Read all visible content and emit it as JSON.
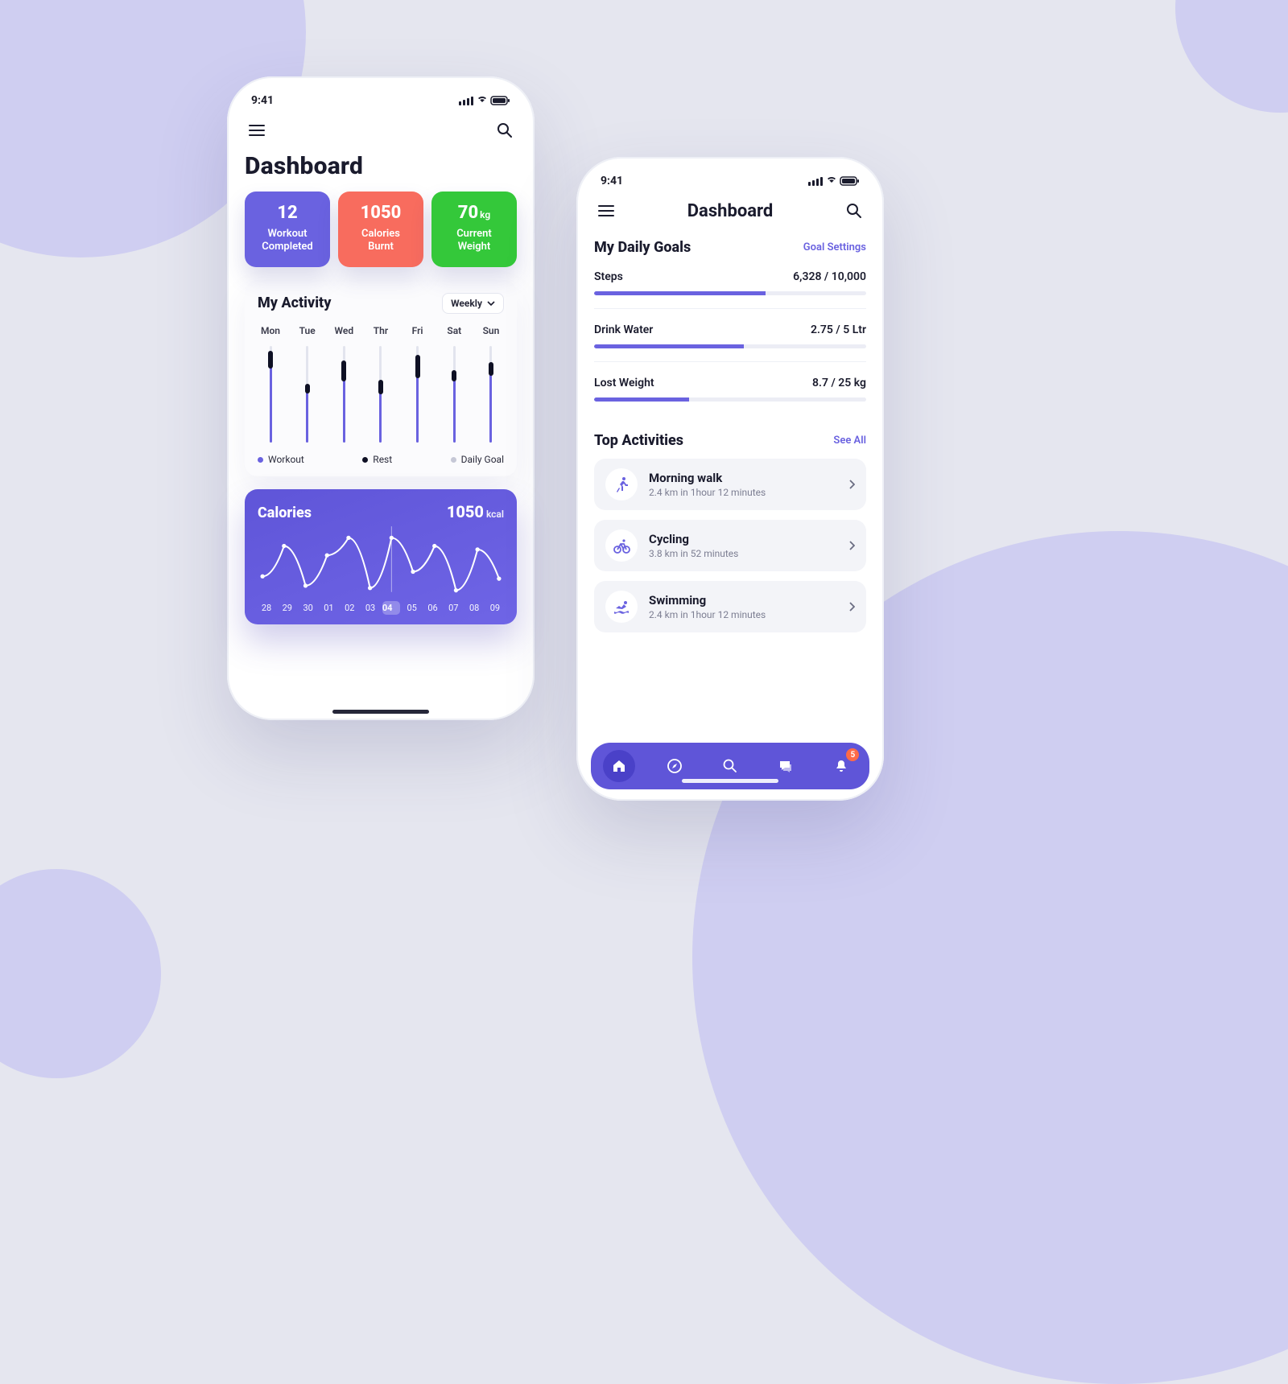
{
  "statusTime": "9:41",
  "screenA": {
    "title": "Dashboard",
    "stats": {
      "workouts": {
        "value": "12",
        "label1": "Workout",
        "label2": "Completed"
      },
      "calories": {
        "value": "1050",
        "label1": "Calories",
        "label2": "Burnt"
      },
      "weight": {
        "value": "70",
        "unit": "kg",
        "label1": "Current",
        "label2": "Weight"
      }
    },
    "activity": {
      "title": "My Activity",
      "range": "Weekly",
      "days": [
        "Mon",
        "Tue",
        "Wed",
        "Thr",
        "Fri",
        "Sat",
        "Sun"
      ],
      "legend": {
        "workout": "Workout",
        "rest": "Rest",
        "goal": "Daily Goal"
      }
    },
    "caloriesCard": {
      "title": "Calories",
      "value": "1050",
      "unit": "kcal",
      "dates": [
        "28",
        "29",
        "30",
        "01",
        "02",
        "03",
        "04",
        "05",
        "06",
        "07",
        "08",
        "09"
      ],
      "activeIndex": 6
    }
  },
  "screenB": {
    "title": "Dashboard",
    "goalsSection": {
      "title": "My Daily Goals",
      "link": "Goal Settings"
    },
    "goals": [
      {
        "name": "Steps",
        "value": "6,328 / 10,000",
        "pct": 63
      },
      {
        "name": "Drink Water",
        "value": "2.75 / 5 Ltr",
        "pct": 55
      },
      {
        "name": "Lost Weight",
        "value": "8.7 / 25 kg",
        "pct": 35
      }
    ],
    "activitiesSection": {
      "title": "Top Activities",
      "link": "See All"
    },
    "activities": [
      {
        "title": "Morning walk",
        "sub": "2.4 km in 1hour 12 minutes",
        "icon": "run"
      },
      {
        "title": "Cycling",
        "sub": "3.8 km in 52 minutes",
        "icon": "bike"
      },
      {
        "title": "Swimming",
        "sub": "2.4 km in 1hour 12 minutes",
        "icon": "swim"
      }
    ],
    "badge": "5"
  },
  "chart_data": [
    {
      "type": "bar",
      "title": "My Activity",
      "categories": [
        "Mon",
        "Tue",
        "Wed",
        "Thr",
        "Fri",
        "Sat",
        "Sun"
      ],
      "series": [
        {
          "name": "Workout",
          "values": [
            90,
            56,
            80,
            60,
            86,
            70,
            78
          ]
        },
        {
          "name": "Rest",
          "values": [
            18,
            10,
            22,
            15,
            24,
            12,
            14
          ]
        },
        {
          "name": "Daily Goal",
          "values": [
            100,
            100,
            100,
            100,
            100,
            100,
            100
          ]
        }
      ],
      "ylim": [
        0,
        100
      ]
    },
    {
      "type": "line",
      "title": "Calories",
      "x": [
        "28",
        "29",
        "30",
        "01",
        "02",
        "03",
        "04",
        "05",
        "06",
        "07",
        "08",
        "09"
      ],
      "values": [
        720,
        980,
        640,
        900,
        1050,
        620,
        1050,
        760,
        980,
        600,
        950,
        700
      ],
      "ylabel": "kcal",
      "highlight_x": "04",
      "highlight_value": 1050
    }
  ]
}
